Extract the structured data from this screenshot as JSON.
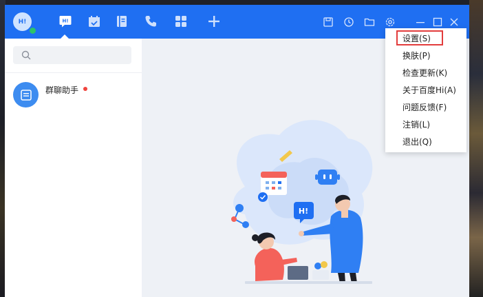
{
  "app": {
    "logo_text": "H!"
  },
  "nav": {
    "items": [
      {
        "icon": "hi-chat-icon",
        "active": true
      },
      {
        "icon": "calendar-check-icon"
      },
      {
        "icon": "notebook-icon"
      },
      {
        "icon": "phone-icon"
      },
      {
        "icon": "apps-grid-icon"
      },
      {
        "icon": "plus-icon"
      }
    ]
  },
  "toolbar": {
    "items": [
      "save-icon",
      "history-icon",
      "folder-icon",
      "settings-gear-icon"
    ]
  },
  "window_controls": [
    "minimize-icon",
    "maximize-icon",
    "close-icon"
  ],
  "search": {
    "placeholder": ""
  },
  "chats": [
    {
      "name": "群聊助手",
      "unread": true
    }
  ],
  "menu": {
    "items": [
      {
        "label": "设置(S)",
        "highlighted": true
      },
      {
        "label": "换肤(P)"
      },
      {
        "label": "检查更新(K)"
      },
      {
        "label": "关于百度Hi(A)"
      },
      {
        "label": "问题反馈(F)"
      },
      {
        "label": "注销(L)"
      },
      {
        "label": "退出(Q)"
      }
    ]
  },
  "illustration": {
    "bubble_text": "H!"
  },
  "colors": {
    "primary": "#1f6ff2",
    "online": "#2bc36b",
    "unread": "#f0443e",
    "highlight_border": "#e23c3c"
  }
}
